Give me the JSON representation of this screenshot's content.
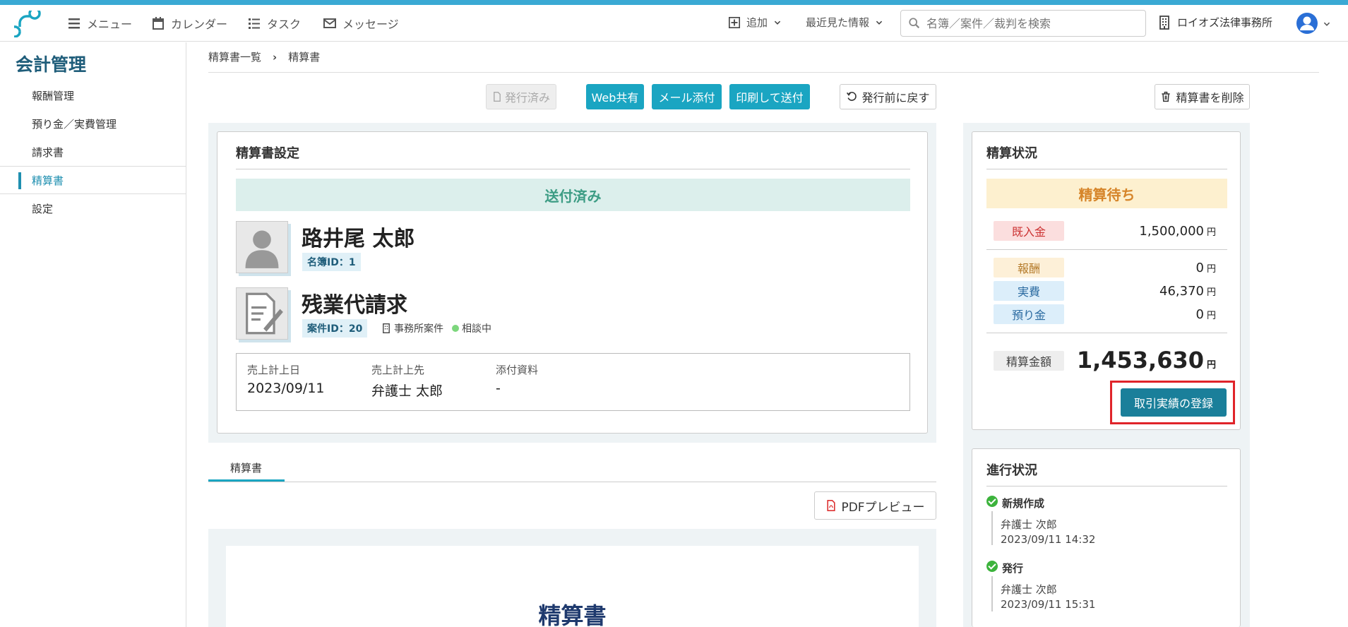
{
  "nav": {
    "menu": "メニュー",
    "calendar": "カレンダー",
    "task": "タスク",
    "message": "メッセージ",
    "add": "追加",
    "recent": "最近見た情報",
    "search_placeholder": "名簿／案件／裁判を検索",
    "firm": "ロイオズ法律事務所"
  },
  "sidebar": {
    "title": "会計管理",
    "items": [
      "報酬管理",
      "預り金／実費管理",
      "請求書",
      "精算書",
      "設定"
    ]
  },
  "breadcrumb": {
    "parent": "精算書一覧",
    "sep": "›",
    "current": "精算書"
  },
  "actions": {
    "issued": "発行済み",
    "web_share": "Web共有",
    "mail_attach": "メール添付",
    "print_send": "印刷して送付",
    "revert": "発行前に戻す",
    "delete": "精算書を削除"
  },
  "settings": {
    "title": "精算書設定",
    "status": "送付済み",
    "person_name": "路井尾 太郎",
    "person_id": "名簿ID：1",
    "case_name": "残業代請求",
    "case_id": "案件ID：20",
    "case_type": "事務所案件",
    "case_status": "相談中",
    "sales_date_label": "売上計上日",
    "sales_date": "2023/09/11",
    "sales_to_label": "売上計上先",
    "sales_to": "弁護士 太郎",
    "attach_label": "添付資料",
    "attach": "-"
  },
  "tabs": {
    "doc": "精算書"
  },
  "pdf_preview": "PDFプレビュー",
  "preview_title": "精算書",
  "status_panel": {
    "title": "精算状況",
    "state": "精算待ち",
    "deposit_label": "既入金",
    "deposit": "1,500,000",
    "fee_label": "報酬",
    "fee": "0",
    "expense_label": "実費",
    "expense": "46,370",
    "custody_label": "預り金",
    "custody": "0",
    "total_label": "精算金額",
    "total": "1,453,630",
    "yen": "円",
    "register": "取引実績の登録"
  },
  "progress": {
    "title": "進行状況",
    "steps": [
      {
        "label": "新規作成",
        "user": "弁護士 次郎",
        "time": "2023/09/11 14:32"
      },
      {
        "label": "発行",
        "user": "弁護士 次郎",
        "time": "2023/09/11 15:31"
      }
    ]
  },
  "colors": {
    "accent": "#1aa5c2",
    "highlight": "#e0242a"
  }
}
